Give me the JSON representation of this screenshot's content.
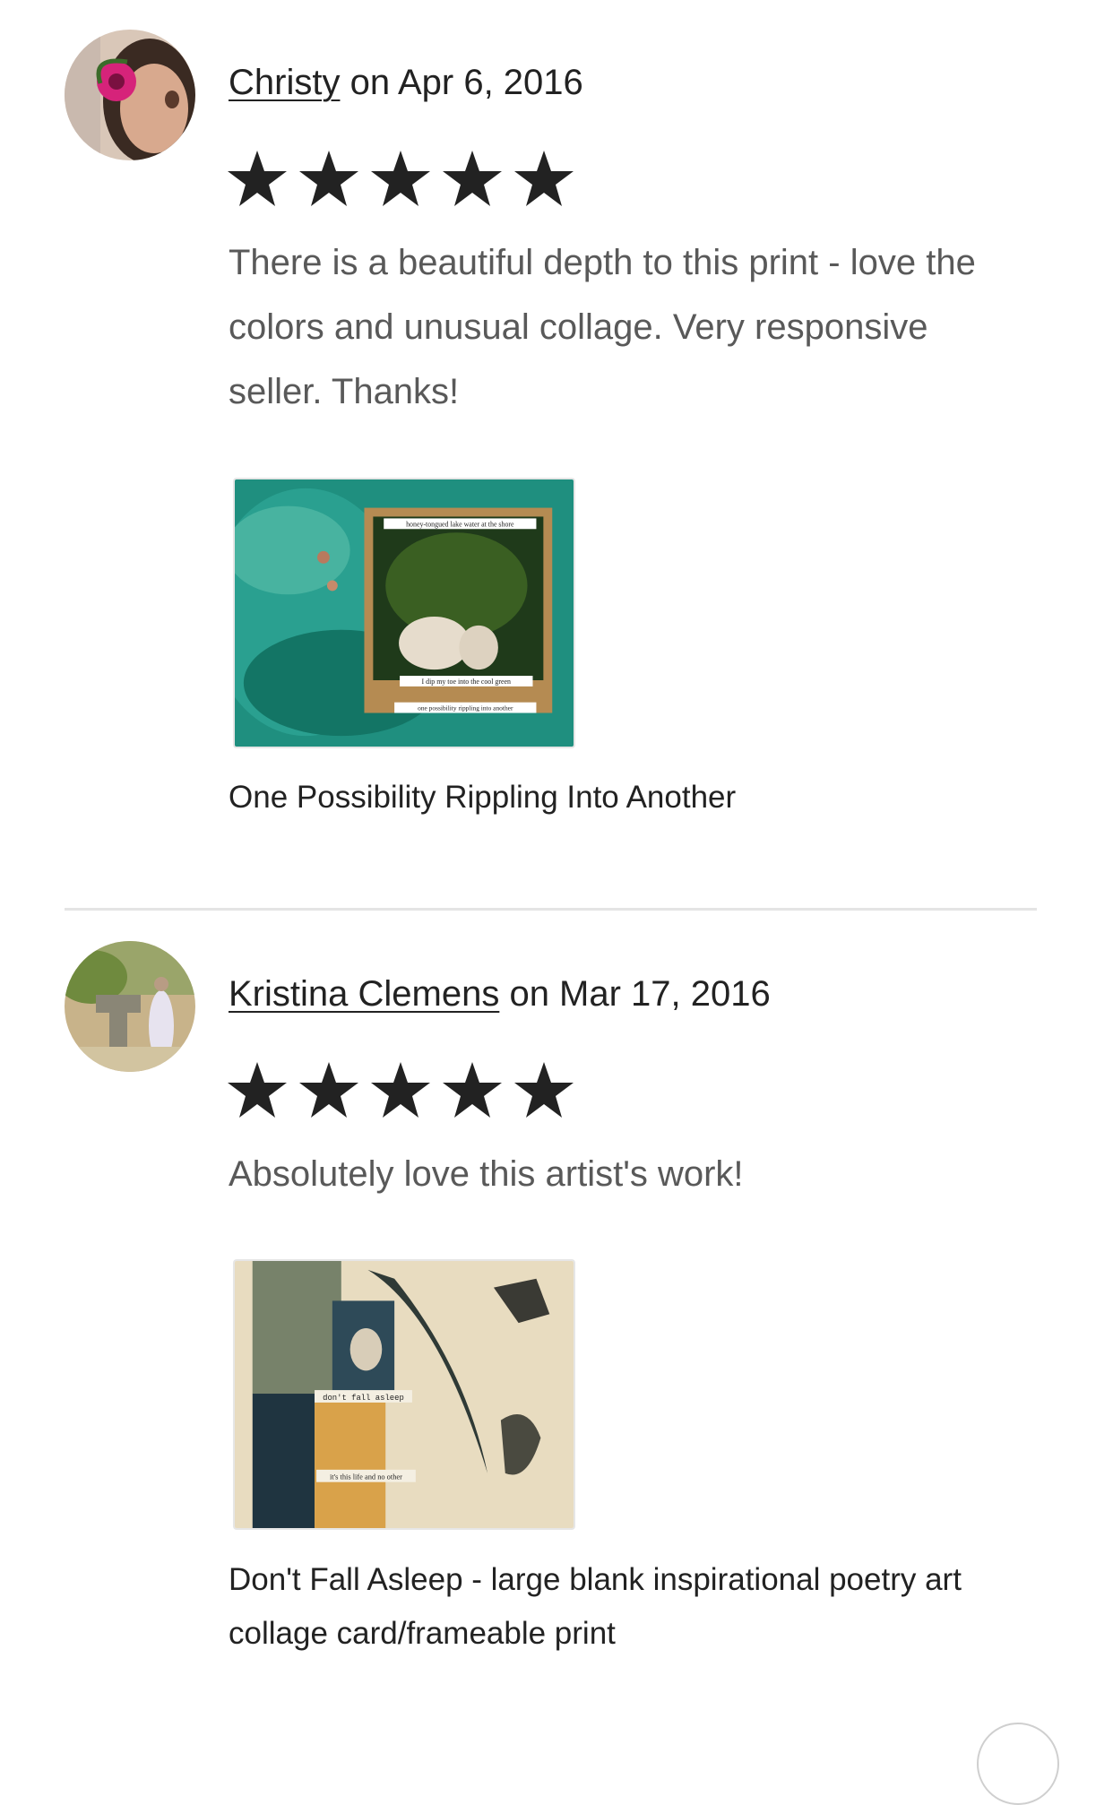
{
  "reviews": [
    {
      "reviewer": "Christy",
      "date_text": " on Apr 6, 2016",
      "rating": 5,
      "text": "There is a beautiful depth to this print - love the colors and unusual collage. Very responsive seller. Thanks!",
      "item": {
        "title": "One Possibility Rippling Into Another",
        "image_texts": [
          "honey-tongued lake water at the shore",
          "I dip my toe into the cool green",
          "one possibility rippling into another"
        ]
      }
    },
    {
      "reviewer": "Kristina Clemens",
      "date_text": " on Mar 17, 2016",
      "rating": 5,
      "text": "Absolutely love this artist's work!",
      "item": {
        "title": "Don't Fall Asleep - large blank inspirational poetry art collage card/frameable print",
        "image_texts": [
          "don't fall asleep",
          "it's this life and no other"
        ]
      }
    }
  ],
  "icons": {
    "star": "star-icon",
    "star_color": "#222222"
  }
}
